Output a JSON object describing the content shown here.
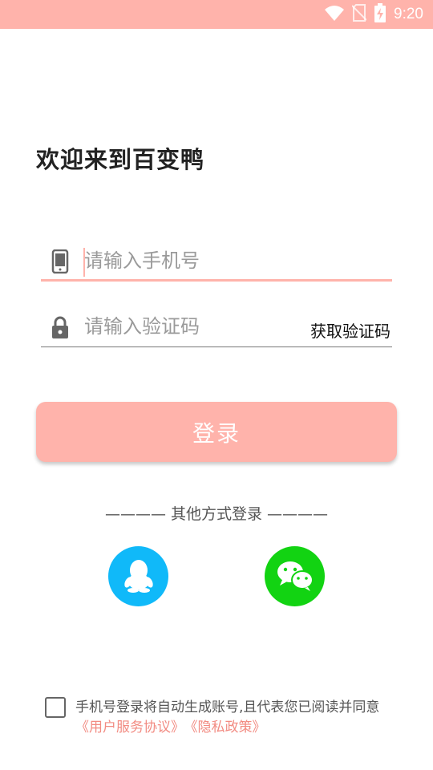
{
  "status_bar": {
    "time": "9:20",
    "icons": [
      "wifi-icon",
      "no-sim-icon",
      "battery-charging-icon"
    ],
    "color": "#FFB3AB"
  },
  "welcome_title": "欢迎来到百变鸭",
  "phone_field": {
    "placeholder": "请输入手机号",
    "icon": "phone-icon"
  },
  "code_field": {
    "placeholder": "请输入验证码",
    "icon": "lock-icon",
    "get_code_label": "获取验证码"
  },
  "login_button": {
    "label": "登录",
    "color": "#FFB3AB"
  },
  "other_login": {
    "label": "———— 其他方式登录 ————",
    "options": [
      {
        "name": "qq-icon",
        "color": "#10B9F9"
      },
      {
        "name": "wechat-icon",
        "color": "#12D312"
      }
    ]
  },
  "agreement": {
    "checked": false,
    "text": "手机号登录将自动生成账号,且代表您已阅读并同意",
    "user_agreement": "《用户服务协议》",
    "privacy_policy": "《隐私政策》",
    "link_color": "#F28B82"
  }
}
